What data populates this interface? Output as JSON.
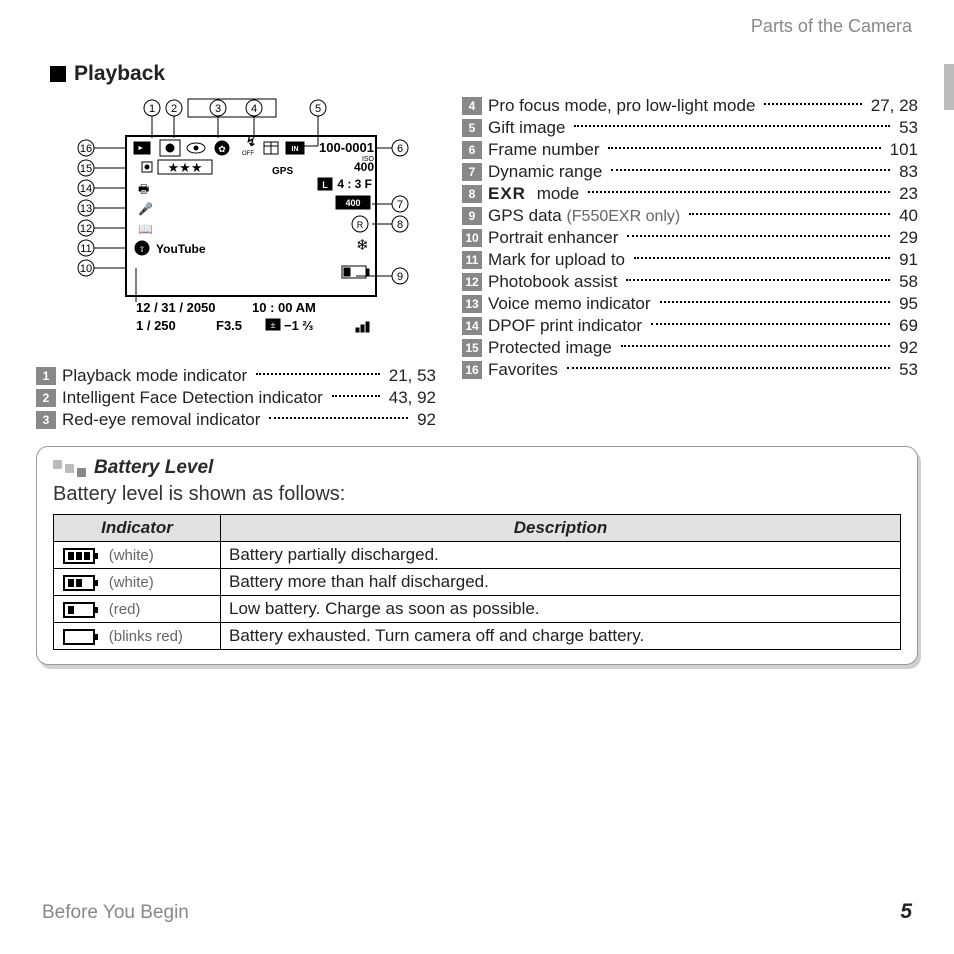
{
  "header_right": "Parts of the Camera",
  "section_title": "Playback",
  "diagram": {
    "file_number": "100-0001",
    "iso_label": "ISO",
    "iso_value": "400",
    "aspect_size": "4 : 3 F",
    "size_prefix": "L",
    "dr_badge": "400",
    "gps": "GPS",
    "youtube": "YouTube",
    "date": "12 / 31 / 2050",
    "time": "10 : 00  AM",
    "shutter": "1 / 250",
    "aperture": "F3.5",
    "ev": "−1 ⅔"
  },
  "index_left": [
    {
      "n": "1",
      "label": "Playback mode indicator",
      "page": "21, 53"
    },
    {
      "n": "2",
      "label": "Intelligent Face Detection indicator",
      "page": "43, 92"
    },
    {
      "n": "3",
      "label": "Red-eye removal indicator",
      "page": "92"
    }
  ],
  "index_right": [
    {
      "n": "4",
      "label": "Pro focus mode, pro low-light mode",
      "page": "27, 28"
    },
    {
      "n": "5",
      "label": "Gift image",
      "page": "53"
    },
    {
      "n": "6",
      "label": "Frame number",
      "page": "101"
    },
    {
      "n": "7",
      "label": "Dynamic range",
      "page": "83"
    },
    {
      "n": "8",
      "label": "EXR mode",
      "label_is_logo": true,
      "page": "23"
    },
    {
      "n": "9",
      "label": "GPS data",
      "paren": "(F550EXR only)",
      "page": "40"
    },
    {
      "n": "10",
      "label": "Portrait enhancer",
      "page": "29"
    },
    {
      "n": "11",
      "label": "Mark for upload to",
      "page": "91"
    },
    {
      "n": "12",
      "label": "Photobook assist",
      "page": "58"
    },
    {
      "n": "13",
      "label": "Voice memo indicator",
      "page": "95"
    },
    {
      "n": "14",
      "label": "DPOF print indicator",
      "page": "69"
    },
    {
      "n": "15",
      "label": "Protected image",
      "page": "92"
    },
    {
      "n": "16",
      "label": "Favorites",
      "page": "53"
    }
  ],
  "battery": {
    "title": "Battery Level",
    "subtitle": "Battery level is shown as follows:",
    "col_indicator": "Indicator",
    "col_description": "Description",
    "rows": [
      {
        "fill": "3",
        "note": "(white)",
        "desc": "Battery partially discharged."
      },
      {
        "fill": "2",
        "note": "(white)",
        "desc": "Battery more than half discharged."
      },
      {
        "fill": "1",
        "note": "(red)",
        "desc": "Low battery.  Charge as soon as possible."
      },
      {
        "fill": "0",
        "note": "(blinks red)",
        "desc": "Battery exhausted.  Turn camera off and charge battery."
      }
    ]
  },
  "footer": "Before You Begin",
  "page_number": "5"
}
